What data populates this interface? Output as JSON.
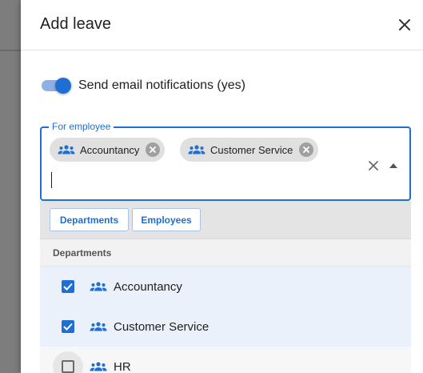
{
  "dialog": {
    "title": "Add leave",
    "notifications": {
      "label": "Send email notifications (yes)",
      "enabled": true
    },
    "employee_field": {
      "label": "For employee",
      "chips": [
        {
          "label": "Accountancy",
          "icon": "group-icon"
        },
        {
          "label": "Customer Service",
          "icon": "group-icon"
        }
      ],
      "input_value": ""
    },
    "dropdown": {
      "filters": [
        "Departments",
        "Employees"
      ],
      "group_header": "Departments",
      "options": [
        {
          "label": "Accountancy",
          "checked": true,
          "icon": "group-icon"
        },
        {
          "label": "Customer Service",
          "checked": true,
          "icon": "group-icon"
        },
        {
          "label": "HR",
          "checked": false,
          "icon": "group-icon"
        }
      ]
    }
  },
  "colors": {
    "accent": "#1f6fd3",
    "selected_row": "#eaf1fa",
    "chip_bg": "#e0e0e0",
    "backdrop": "#7d7d7d"
  }
}
